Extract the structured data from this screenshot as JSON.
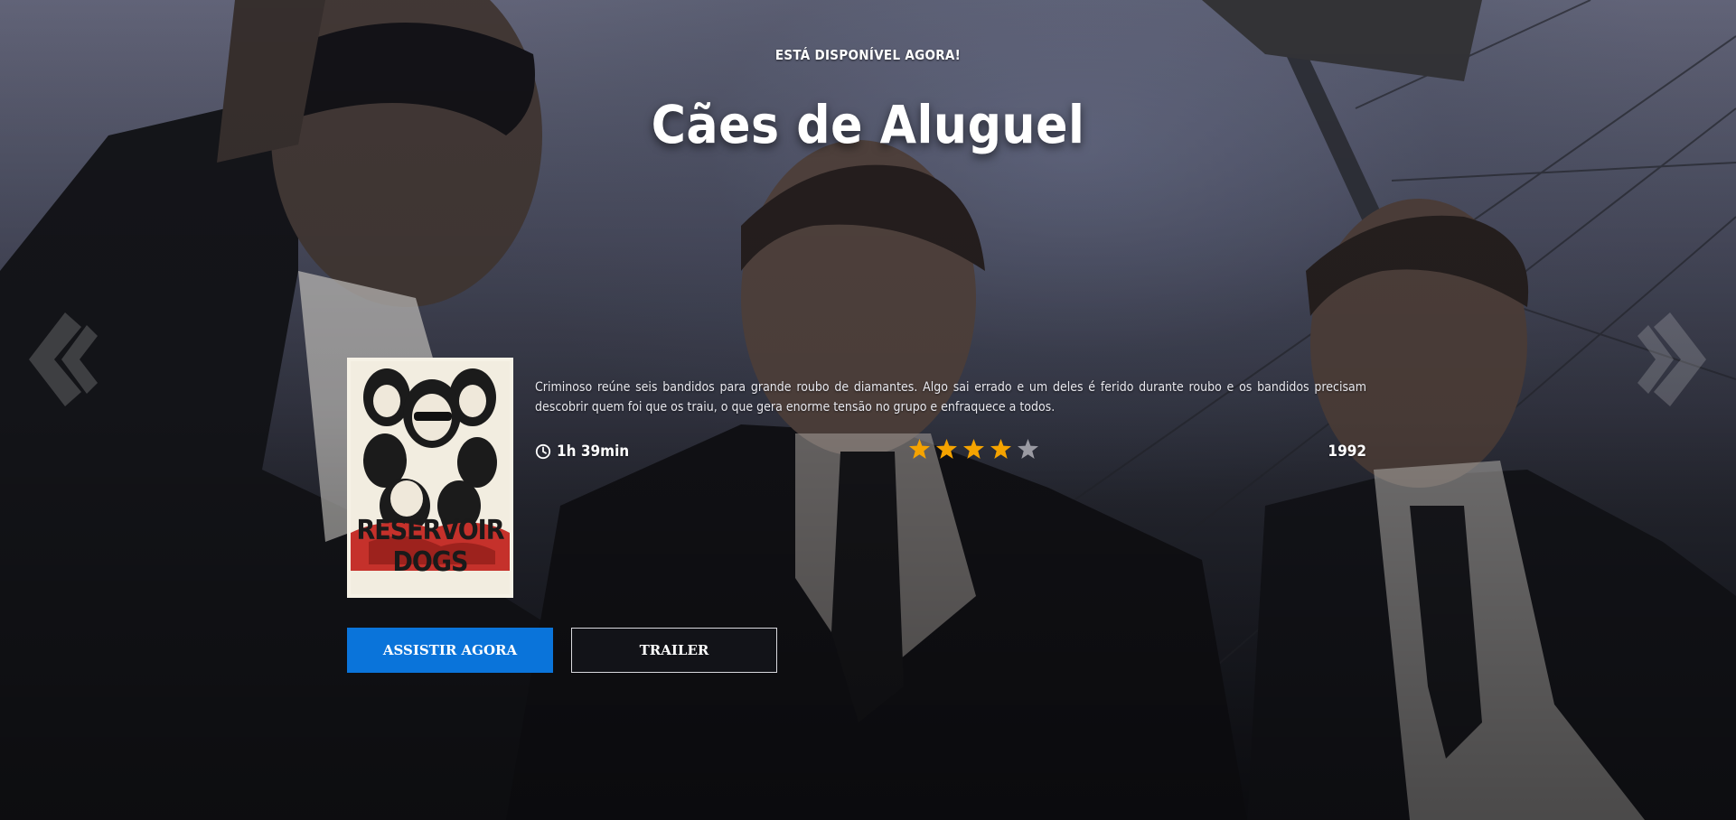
{
  "hero": {
    "kicker": "ESTÁ DISPONÍVEL AGORA!",
    "title": "Cães de Aluguel",
    "description": "Criminoso reúne seis bandidos para grande roubo de diamantes. Algo sai errado e um deles é ferido durante roubo e os bandidos precisam descobrir quem foi que os traiu, o que gera enorme tensão no grupo e enfraquece a todos.",
    "duration": "1h 39min",
    "year": "1992",
    "rating": {
      "value": 4,
      "max": 5
    },
    "poster": {
      "label": "RESERVOIR DOGS"
    },
    "buttons": {
      "watch": "ASSISTIR AGORA",
      "trailer": "TRAILER"
    }
  },
  "navigation": {
    "prev_icon": "double-chevron-left-icon",
    "next_icon": "double-chevron-right-icon"
  },
  "colors": {
    "accent": "#0a74da",
    "star_filled": "#f5a300",
    "star_empty": "#9a9aa2",
    "trailer_bg": "#121318"
  }
}
